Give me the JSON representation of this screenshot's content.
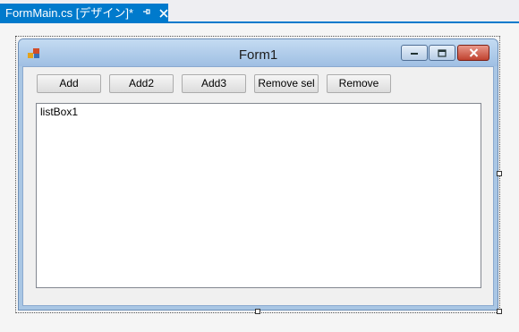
{
  "document_tab": {
    "title": "FormMain.cs [デザイン]*",
    "pin_icon": "pin-icon",
    "close_icon": "close-icon"
  },
  "form": {
    "title": "Form1",
    "buttons": [
      {
        "label": "Add"
      },
      {
        "label": "Add2"
      },
      {
        "label": "Add3"
      },
      {
        "label": "Remove sel"
      },
      {
        "label": "Remove"
      }
    ],
    "listbox": {
      "items": [
        "listBox1"
      ]
    }
  },
  "colors": {
    "tab_accent": "#007acc",
    "titlebar": "#a9c6e4",
    "close_button": "#c0422f"
  }
}
